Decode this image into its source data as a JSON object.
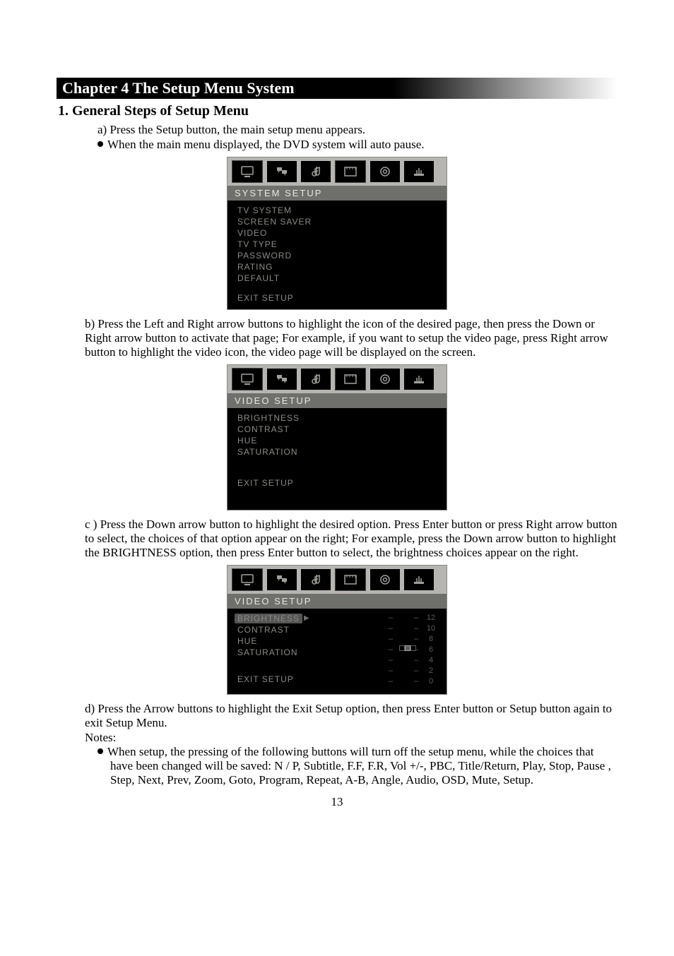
{
  "chapter_title": "Chapter 4 The Setup Menu System",
  "section1_title": "1.  General Steps of Setup Menu",
  "step_a": "a)  Press the Setup button, the main setup menu appears.",
  "bullet_a": "When the main menu displayed, the DVD system will auto pause.",
  "menu1": {
    "title": "SYSTEM SETUP",
    "items": [
      "TV SYSTEM",
      "SCREEN SAVER",
      "VIDEO",
      "TV TYPE",
      "PASSWORD",
      "RATING",
      "DEFAULT"
    ],
    "exit": "EXIT SETUP"
  },
  "step_b": "b)  Press the Left and Right arrow buttons to highlight the icon of the desired page, then press the Down or Right arrow button to activate that page; For example, if you want to setup the video page, press Right arrow button to highlight  the video icon, the video page will be displayed on the screen.",
  "menu2": {
    "title": "VIDEO   SETUP",
    "items": [
      "BRIGHTNESS",
      "CONTRAST",
      "HUE",
      "SATURATION"
    ],
    "exit": "EXIT SETUP"
  },
  "step_c": "c )  Press the Down arrow button to highlight the desired option. Press Enter button or press Right arrow button to select, the choices of that option appear on the right; For example, press the Down arrow button to highlight  the BRIGHTNESS option, then press Enter button to select, the brightness choices appear on the right.",
  "menu3": {
    "title": "VIDEO   SETUP",
    "items": [
      "BRIGHTNESS",
      "CONTRAST",
      "HUE",
      "SATURATION"
    ],
    "exit": "EXIT SETUP",
    "scale_values": [
      "12",
      "10",
      "8",
      "6",
      "4",
      "2",
      "0"
    ]
  },
  "step_d": "d)  Press the Arrow buttons to highlight the Exit Setup option, then press Enter button or Setup button again to exit Setup Menu.",
  "notes_label": "Notes:",
  "notes_bullet": "When setup, the pressing of the following buttons will turn off the setup menu, while the choices that have been changed will be saved: N / P, Subtitle, F.F, F.R, Vol +/-, PBC, Title/Return, Play, Stop, Pause , Step, Next, Prev, Zoom,  Goto, Program, Repeat, A-B, Angle, Audio, OSD, Mute, Setup.",
  "page_number": "13"
}
